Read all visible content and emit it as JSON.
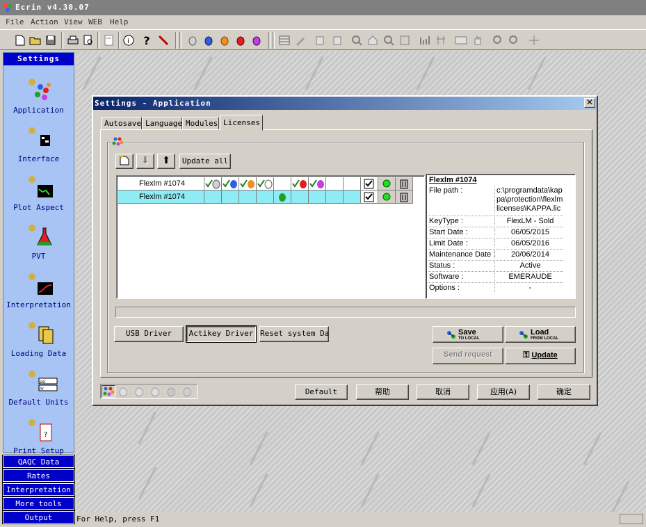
{
  "app": {
    "title": "Ecrin  v4.30.07"
  },
  "menu": [
    "File",
    "Action",
    "View",
    "WEB",
    "Help"
  ],
  "sidebar": {
    "header": "Settings",
    "items": [
      {
        "label": "Application",
        "icon": "application-icon"
      },
      {
        "label": "Interface",
        "icon": "interface-icon"
      },
      {
        "label": "Plot Aspect",
        "icon": "plot-aspect-icon"
      },
      {
        "label": "PVT",
        "icon": "pvt-flask-icon"
      },
      {
        "label": "Interpretation",
        "icon": "interpretation-icon"
      },
      {
        "label": "Loading Data",
        "icon": "loading-data-icon"
      },
      {
        "label": "Default Units",
        "icon": "default-units-icon",
        "unit_select_1": "psi",
        "unit_select_2": "hr"
      },
      {
        "label": "Print Setup",
        "icon": "print-setup-icon"
      }
    ],
    "sections": [
      "QAQC Data",
      "Rates",
      "Interpretation",
      "More tools",
      "Output"
    ]
  },
  "status": {
    "help": "For Help, press F1"
  },
  "dialog": {
    "title": "Settings - Application",
    "tabs": [
      "Autosave",
      "Language",
      "Modules",
      "Licenses"
    ],
    "active_tab": "Licenses",
    "update_all": "Update all",
    "licenses": [
      {
        "name": "Flexlm #1074",
        "selected": false
      },
      {
        "name": "Flexlm #1074",
        "selected": true
      }
    ],
    "info": {
      "title": "Flexlm #1074",
      "rows": [
        {
          "label": "File path :",
          "value_lines": [
            "c:\\programdata\\kap",
            "pa\\protection\\flexlm",
            "licenses\\KAPPA.lic"
          ]
        },
        {
          "label": "KeyType :",
          "value": "FlexLM - Sold"
        },
        {
          "label": "Start Date :",
          "value": "06/05/2015"
        },
        {
          "label": "Limit Date :",
          "value": "06/05/2016"
        },
        {
          "label": "Maintenance Date :",
          "value": "20/06/2014"
        },
        {
          "label": "Status :",
          "value": "Active"
        },
        {
          "label": "Software :",
          "value": "EMERAUDE"
        },
        {
          "label": "Options :",
          "value": "-"
        }
      ]
    },
    "buttons": {
      "usb_driver": "USB Driver",
      "actikey_driver": "Actikey Driver",
      "reset_date": "Reset system Date",
      "save": "Save",
      "save_sub": "TO LOCAL",
      "load": "Load",
      "load_sub": "FROM LOCAL",
      "send_request": "Send request",
      "update": "Update"
    },
    "footer": {
      "default": "Default",
      "help": "帮助",
      "cancel": "取消",
      "apply": "应用(A)",
      "ok": "确定"
    }
  },
  "colors": {
    "selected_row": "#90ecf4",
    "sidebar_panel": "#a7c4f4",
    "sidebar_button": "#0000c8",
    "title_gradient_start": "#0a246a"
  }
}
